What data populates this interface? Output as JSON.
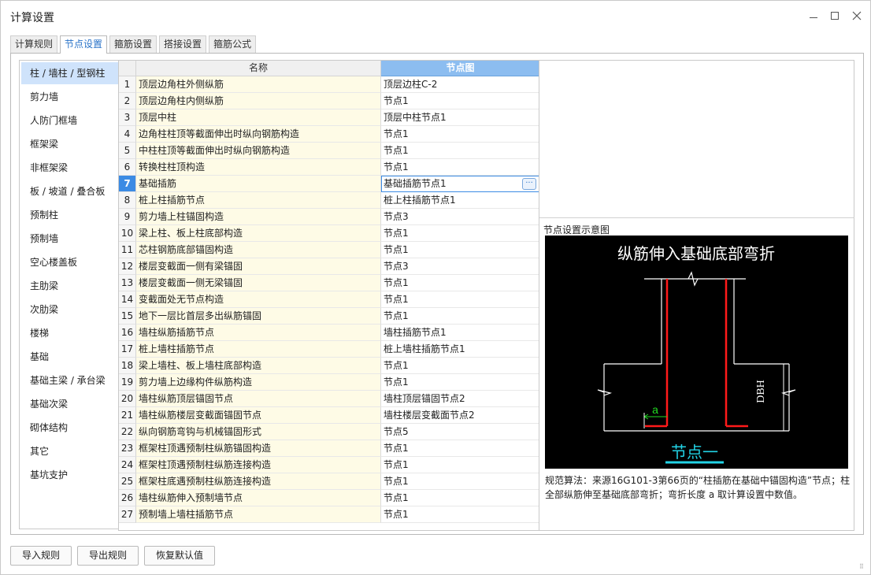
{
  "window": {
    "title": "计算设置",
    "minimize_icon": "minimize-icon",
    "maximize_icon": "maximize-icon",
    "close_icon": "close-icon"
  },
  "tabs": [
    {
      "label": "计算规则",
      "active": false
    },
    {
      "label": "节点设置",
      "active": true
    },
    {
      "label": "箍筋设置",
      "active": false
    },
    {
      "label": "搭接设置",
      "active": false
    },
    {
      "label": "箍筋公式",
      "active": false
    }
  ],
  "sidebar": {
    "items": [
      {
        "label": "柱 / 墙柱 / 型钢柱",
        "active": true
      },
      {
        "label": "剪力墙"
      },
      {
        "label": "人防门框墙"
      },
      {
        "label": "框架梁"
      },
      {
        "label": "非框架梁"
      },
      {
        "label": "板 / 坡道 / 叠合板"
      },
      {
        "label": "预制柱"
      },
      {
        "label": "预制墙"
      },
      {
        "label": "空心楼盖板"
      },
      {
        "label": "主肋梁"
      },
      {
        "label": "次肋梁"
      },
      {
        "label": "楼梯"
      },
      {
        "label": "基础"
      },
      {
        "label": "基础主梁 / 承台梁"
      },
      {
        "label": "基础次梁"
      },
      {
        "label": "砌体结构"
      },
      {
        "label": "其它"
      },
      {
        "label": "基坑支护"
      }
    ]
  },
  "grid": {
    "headers": {
      "name": "名称",
      "node": "节点图"
    },
    "selected_row": 7,
    "rows": [
      {
        "num": "1",
        "name": "顶层边角柱外侧纵筋",
        "node": "顶层边柱C-2"
      },
      {
        "num": "2",
        "name": "顶层边角柱内侧纵筋",
        "node": "节点1"
      },
      {
        "num": "3",
        "name": "顶层中柱",
        "node": "顶层中柱节点1"
      },
      {
        "num": "4",
        "name": "边角柱柱顶等截面伸出时纵向钢筋构造",
        "node": "节点1"
      },
      {
        "num": "5",
        "name": "中柱柱顶等截面伸出时纵向钢筋构造",
        "node": "节点1"
      },
      {
        "num": "6",
        "name": "转换柱柱顶构造",
        "node": "节点1"
      },
      {
        "num": "7",
        "name": "基础插筋",
        "node": "基础插筋节点1"
      },
      {
        "num": "8",
        "name": "桩上柱插筋节点",
        "node": "桩上柱插筋节点1"
      },
      {
        "num": "9",
        "name": "剪力墙上柱锚固构造",
        "node": "节点3"
      },
      {
        "num": "10",
        "name": "梁上柱、板上柱底部构造",
        "node": "节点1"
      },
      {
        "num": "11",
        "name": "芯柱钢筋底部锚固构造",
        "node": "节点1"
      },
      {
        "num": "12",
        "name": "楼层变截面一侧有梁锚固",
        "node": "节点3"
      },
      {
        "num": "13",
        "name": "楼层变截面一侧无梁锚固",
        "node": "节点1"
      },
      {
        "num": "14",
        "name": "变截面处无节点构造",
        "node": "节点1"
      },
      {
        "num": "15",
        "name": "地下一层比首层多出纵筋锚固",
        "node": "节点1"
      },
      {
        "num": "16",
        "name": "墙柱纵筋插筋节点",
        "node": "墙柱插筋节点1"
      },
      {
        "num": "17",
        "name": "桩上墙柱插筋节点",
        "node": "桩上墙柱插筋节点1"
      },
      {
        "num": "18",
        "name": "梁上墙柱、板上墙柱底部构造",
        "node": "节点1"
      },
      {
        "num": "19",
        "name": "剪力墙上边缘构件纵筋构造",
        "node": "节点1"
      },
      {
        "num": "20",
        "name": "墙柱纵筋顶层锚固节点",
        "node": "墙柱顶层锚固节点2"
      },
      {
        "num": "21",
        "name": "墙柱纵筋楼层变截面锚固节点",
        "node": "墙柱楼层变截面节点2"
      },
      {
        "num": "22",
        "name": "纵向钢筋弯钩与机械锚固形式",
        "node": "节点5"
      },
      {
        "num": "23",
        "name": "框架柱顶遇预制柱纵筋锚固构造",
        "node": "节点1"
      },
      {
        "num": "24",
        "name": "框架柱顶遇预制柱纵筋连接构造",
        "node": "节点1"
      },
      {
        "num": "25",
        "name": "框架柱底遇预制柱纵筋连接构造",
        "node": "节点1"
      },
      {
        "num": "26",
        "name": "墙柱纵筋伸入预制墙节点",
        "node": "节点1"
      },
      {
        "num": "27",
        "name": "预制墙上墙柱插筋节点",
        "node": "节点1"
      }
    ],
    "edit_button_icon": "ellipsis-icon",
    "edit_button_label": "···"
  },
  "preview": {
    "label": "节点设置示意图",
    "diagram": {
      "title": "纵筋伸入基础底部弯折",
      "dimension_label": "DBH",
      "a_label": "a",
      "node_label": "节点一",
      "colors": {
        "background": "#000000",
        "rebar": "#ff1a1a",
        "lines": "#ffffff",
        "dimension_a": "#22dd22",
        "node_label": "#22d3e6"
      }
    },
    "rule_text": "规范算法：来源16G101-3第66页的“柱插筋在基础中锚固构造”节点；柱全部纵筋伸至基础底部弯折；弯折长度 a 取计算设置中数值。"
  },
  "bottom_buttons": {
    "import": "导入规则",
    "export": "导出规则",
    "restore": "恢复默认值"
  }
}
